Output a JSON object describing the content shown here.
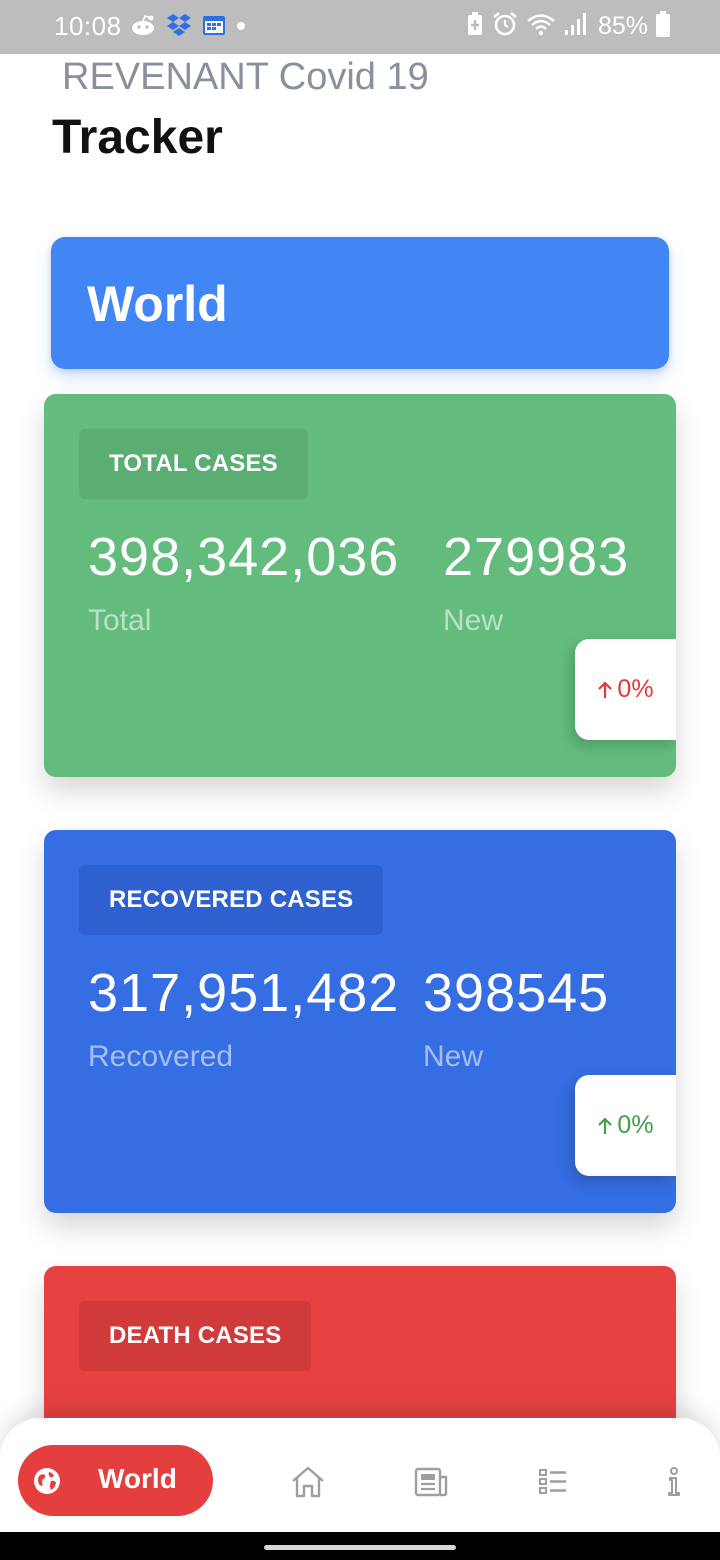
{
  "status_bar": {
    "time": "10:08",
    "battery": "85%",
    "left_icons": [
      "reddit-icon",
      "dropbox-icon",
      "calendar-icon",
      "dot-icon"
    ],
    "right_icons": [
      "battery-saver-icon",
      "alarm-icon",
      "wifi-icon",
      "signal-icon",
      "battery-icon"
    ]
  },
  "header": {
    "title_line1": "REVENANT Covid 19",
    "title_line2": "Tracker"
  },
  "region": {
    "label": "World",
    "color": "#4285F4"
  },
  "cards": [
    {
      "chip_label": "TOTAL CASES",
      "total_value": "398,342,036",
      "total_label": "Total",
      "new_value": "279983",
      "new_label": "New",
      "change": "0%",
      "change_color": "#E53935",
      "color": "#63BC7E",
      "chip_color": "#5AAE72"
    },
    {
      "chip_label": "RECOVERED CASES",
      "total_value": "317,951,482",
      "total_label": "Recovered",
      "new_value": "398545",
      "new_label": "New",
      "change": "0%",
      "change_color": "#43A047",
      "color": "#356DE2",
      "chip_color": "#2F60D0"
    },
    {
      "chip_label": "DEATH CASES",
      "color": "#E54141",
      "chip_color": "#D13A3A"
    }
  ],
  "bottom_nav": {
    "active_label": "World",
    "active_color": "#E53E3E",
    "items": [
      "globe-icon",
      "home-icon",
      "news-icon",
      "list-icon",
      "info-icon"
    ]
  }
}
